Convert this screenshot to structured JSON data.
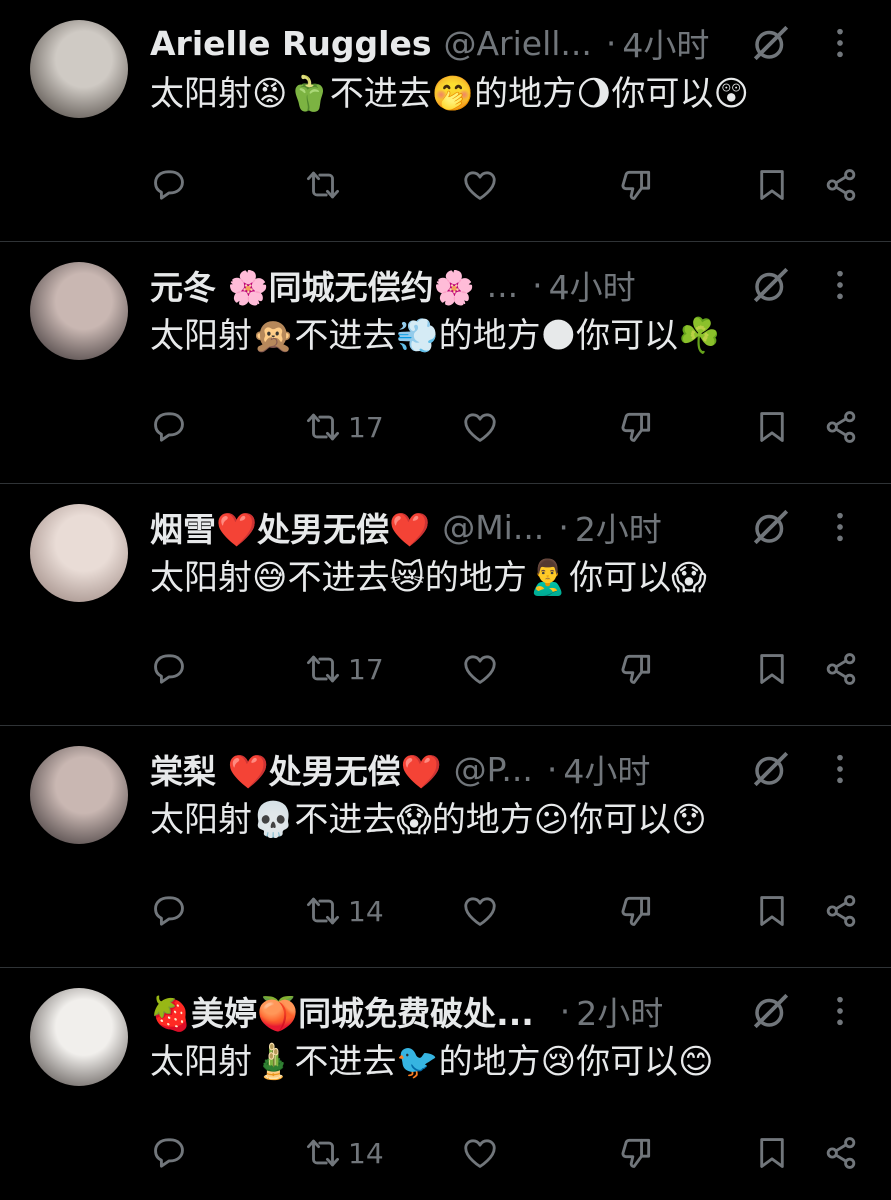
{
  "tweets": [
    {
      "display_name": "Arielle Ruggles",
      "handle": "@Ariell...",
      "time": "4小时",
      "text": "太阳射😡🫑不进去🤭的地方🌖你可以😲",
      "reply_count": "",
      "retweet_count": "",
      "avatar_colors": [
        "#cfcac4",
        "#3a332e"
      ]
    },
    {
      "display_name": "元冬 🌸同城无偿约🌸",
      "handle": "...",
      "time": "4小时",
      "text": "太阳射🙊不进去💨的地方🌑你可以☘️",
      "reply_count": "",
      "retweet_count": "17",
      "avatar_colors": [
        "#c9b7b2",
        "#2a2426"
      ]
    },
    {
      "display_name": "烟雪❤️处男无偿❤️",
      "handle": "@Mi...",
      "time": "2小时",
      "text": "太阳射😅不进去😿的地方🙎‍♂️你可以😱",
      "reply_count": "",
      "retweet_count": "17",
      "avatar_colors": [
        "#e9dcd6",
        "#8f7a74"
      ]
    },
    {
      "display_name": "棠梨 ❤️处男无偿❤️",
      "handle": "@P...",
      "time": "4小时",
      "text": "太阳射💀不进去😱的地方😕你可以😯",
      "reply_count": "",
      "retweet_count": "14",
      "avatar_colors": [
        "#c9b7b2",
        "#2a2426"
      ]
    },
    {
      "display_name": "🍓美婷🍑同城免费破处...",
      "handle": "",
      "time": "2小时",
      "text": "太阳射🎍不进去🐦的地方😢你可以😊",
      "reply_count": "",
      "retweet_count": "14",
      "avatar_colors": [
        "#f1efec",
        "#3b3431"
      ]
    }
  ],
  "colors": {
    "background": "#000000",
    "text_primary": "#e7e9ea",
    "text_secondary": "#71767b",
    "divider": "#2f3336"
  },
  "icons": [
    "reply-icon",
    "retweet-icon",
    "like-icon",
    "dislike-icon",
    "bookmark-icon",
    "share-icon",
    "grok-icon",
    "more-icon"
  ]
}
